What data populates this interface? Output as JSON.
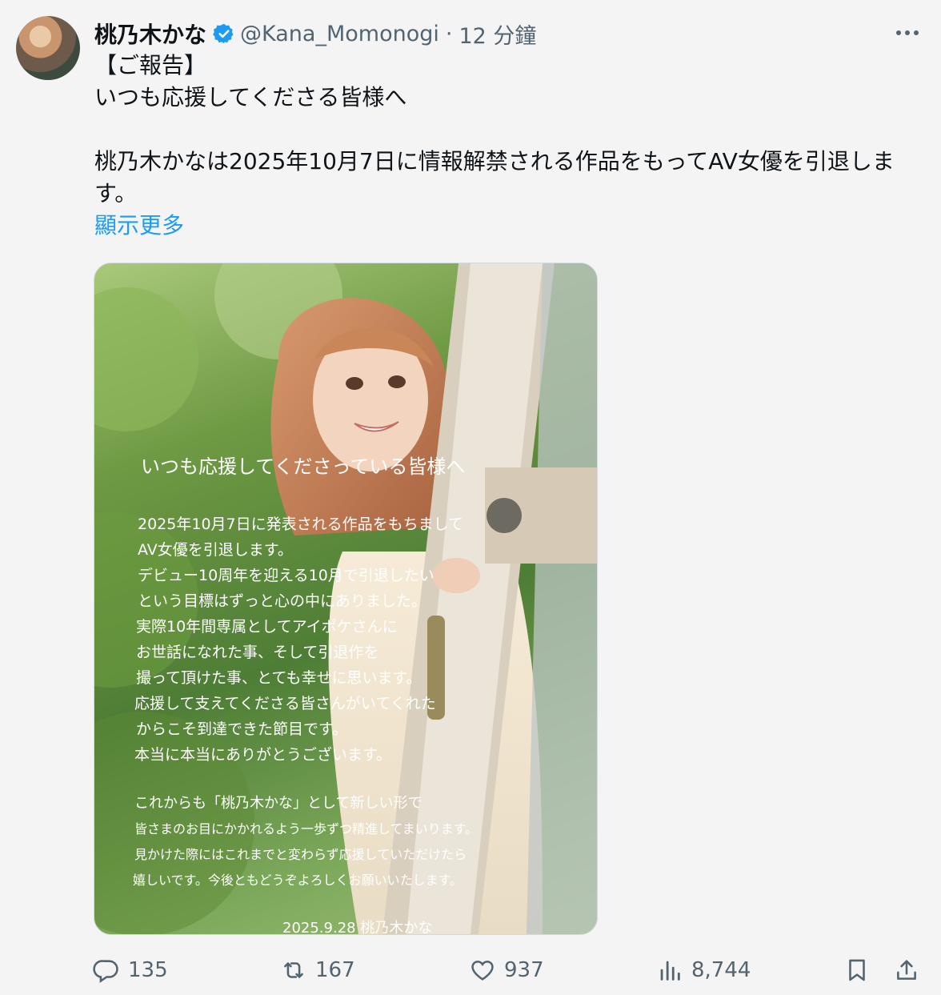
{
  "author": {
    "display_name": "桃乃木かな",
    "handle": "@Kana_Momonogi",
    "separator": "·",
    "time": "12 分鐘",
    "verified_color": "#1d9bf0"
  },
  "post": {
    "lines": [
      "【ご報告】",
      "いつも応援してくださる皆様へ",
      "桃乃木かなは2025年10月7日に情報解禁される作品をもってAV女優を引退します。"
    ],
    "show_more": "顯示更多"
  },
  "media": {
    "letter_lines": [
      "いつも応援してくださっている皆様へ",
      "2025年10月7日に発表される作品をもちまして",
      "AV女優を引退します。",
      "デビュー10周年を迎える10月で引退したい",
      "という目標はずっと心の中にありました。",
      "実際10年間専属としてアイポケさんに",
      "お世話になれた事、そして引退作を",
      "撮って頂けた事、とても幸せに思います。",
      "応援して支えてくださる皆さんがいてくれた",
      "からこそ到達できた節目です。",
      "本当に本当にありがとうございます。",
      "これからも「桃乃木かな」として新しい形で",
      "皆さまのお目にかかれるよう一歩ずつ精進してまいります。",
      "見かけた際にはこれまでと変わらず応援していただけたら",
      "嬉しいです。今後ともどうぞよろしくお願いいたします。",
      "2025.9.28 桃乃木かな"
    ]
  },
  "actions": {
    "replies": "135",
    "reposts": "167",
    "likes": "937",
    "views": "8,744"
  },
  "colors": {
    "muted": "#536471",
    "link": "#1d9bf0",
    "background": "#f5f4f4"
  }
}
